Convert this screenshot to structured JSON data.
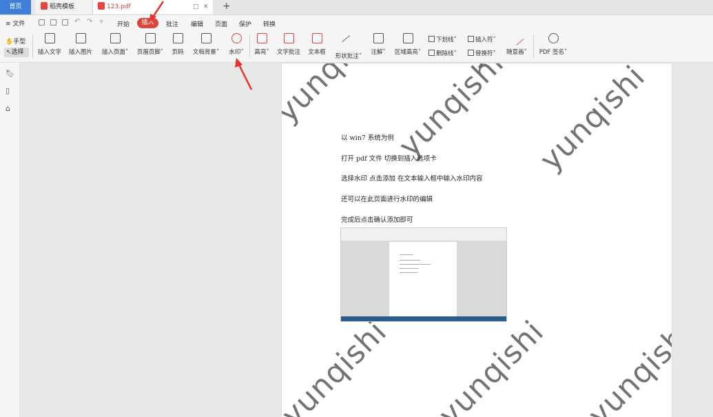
{
  "tabs": {
    "home": "首页",
    "template": "稻壳模板",
    "pdf": "123.pdf",
    "new_tab": "+"
  },
  "menu": {
    "file": "文件",
    "items": [
      "开始",
      "插入",
      "批注",
      "编辑",
      "页面",
      "保护",
      "转换"
    ],
    "active": "插入"
  },
  "ribbon": {
    "hand": "手型",
    "select": "选择",
    "tools": [
      {
        "label": "插入文字"
      },
      {
        "label": "插入图片"
      },
      {
        "label": "插入页面"
      },
      {
        "label": "页眉页脚"
      },
      {
        "label": "页码"
      },
      {
        "label": "文档背景"
      },
      {
        "label": "水印"
      },
      {
        "label": "高亮"
      },
      {
        "label": "文字批注"
      },
      {
        "label": "文本框"
      },
      {
        "label": "形状批注"
      },
      {
        "label": "注解"
      },
      {
        "label": "区域高亮"
      }
    ],
    "small_tools": {
      "underline": "下划线",
      "strike": "删除线",
      "insert_char": "插入符",
      "replace_char": "替换符",
      "pen": "随意画",
      "pdf_sign": "PDF 签名"
    }
  },
  "document": {
    "watermark": "yunqishi",
    "lines": [
      "以 win7 系统为例",
      "打开 pdf 文件   切换到插入选项卡",
      "选择水印     点击添加    在文本输入框中输入水印内容",
      "还可以在此页面进行水印的编辑",
      "完成后点击确认添加即可"
    ]
  },
  "colors": {
    "accent": "#d9463e",
    "home_tab": "#3f7fd8",
    "arrow": "#e8332a"
  }
}
